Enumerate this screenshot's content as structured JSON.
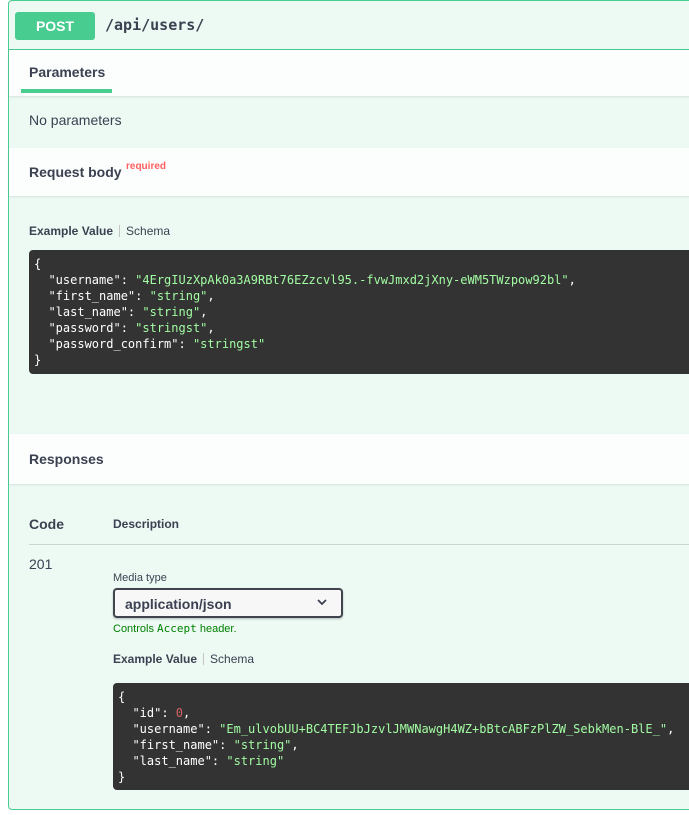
{
  "operation": {
    "method": "POST",
    "path": "/api/users/"
  },
  "parameters": {
    "tab_label": "Parameters",
    "empty_text": "No parameters"
  },
  "request_body": {
    "title": "Request body",
    "required_label": "required",
    "tabs": {
      "example": "Example Value",
      "schema": "Schema"
    },
    "example_lines": [
      {
        "key": "username",
        "value": "4ErgIUzXpAk0a3A9RBt76EZzcvl95.-fvwJmxd2jXny-eWM5TWzpow92bl",
        "type": "str",
        "comma": true
      },
      {
        "key": "first_name",
        "value": "string",
        "type": "str",
        "comma": true
      },
      {
        "key": "last_name",
        "value": "string",
        "type": "str",
        "comma": true
      },
      {
        "key": "password",
        "value": "stringst",
        "type": "str",
        "comma": true
      },
      {
        "key": "password_confirm",
        "value": "stringst",
        "type": "str",
        "comma": false
      }
    ]
  },
  "responses": {
    "title": "Responses",
    "col_code": "Code",
    "col_description": "Description",
    "rows": [
      {
        "code": "201",
        "media_type_label": "Media type",
        "media_type_value": "application/json",
        "controls_text_prefix": "Controls ",
        "controls_text_code": "Accept",
        "controls_text_suffix": " header.",
        "tabs": {
          "example": "Example Value",
          "schema": "Schema"
        },
        "example_lines": [
          {
            "key": "id",
            "value": "0",
            "type": "num",
            "comma": true
          },
          {
            "key": "username",
            "value": "Em_ulvobUU+BC4TEFJbJzvlJMWNawgH4WZ+bBtcABFzPlZW_SebkMen-BlE_",
            "type": "str",
            "comma": true
          },
          {
            "key": "first_name",
            "value": "string",
            "type": "str",
            "comma": true
          },
          {
            "key": "last_name",
            "value": "string",
            "type": "str",
            "comma": false
          }
        ]
      }
    ]
  },
  "colors": {
    "post_green": "#49cc90",
    "code_bg": "#333333",
    "code_string": "#a2fca2",
    "code_number": "#d36363",
    "required_red": "#ff6060"
  },
  "icons": {
    "select_chevron": "chevron-down-icon"
  }
}
